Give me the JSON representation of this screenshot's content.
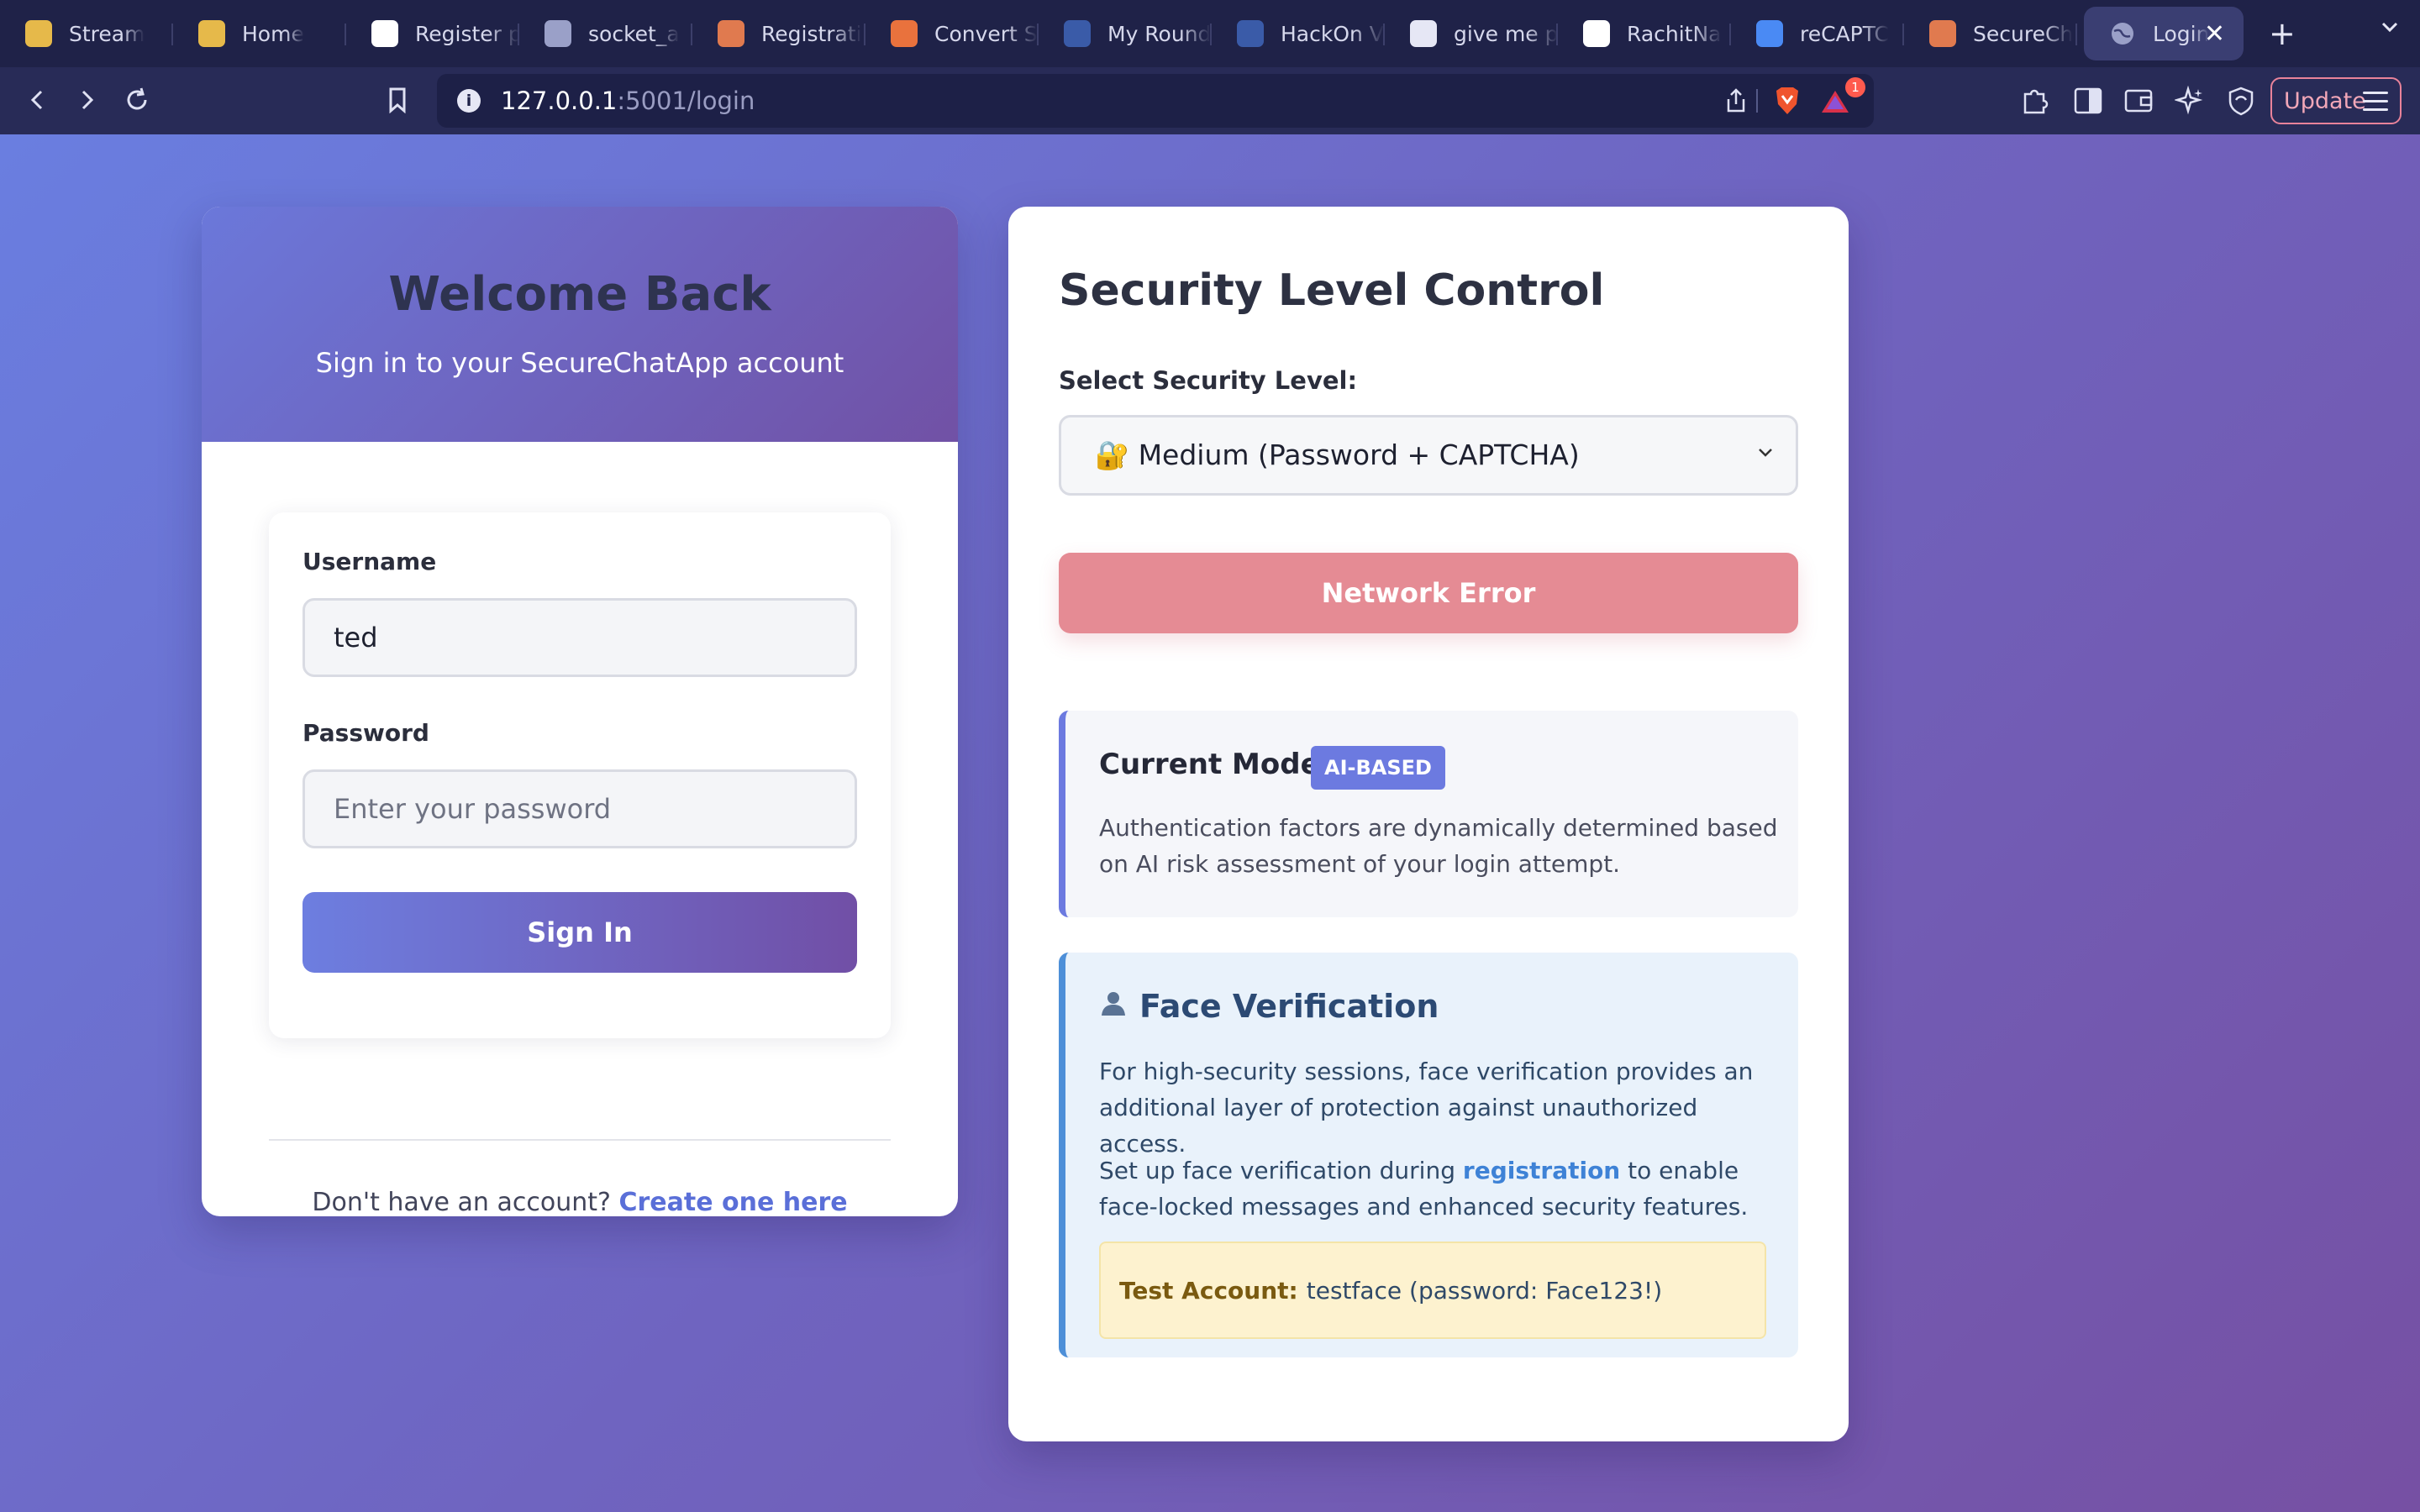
{
  "browser": {
    "tabs": [
      {
        "title": "Stream",
        "favicon": "drive-icon",
        "color": "#e6b94a"
      },
      {
        "title": "Home",
        "favicon": "drive-icon",
        "color": "#e6b94a"
      },
      {
        "title": "Register p",
        "favicon": "openai-icon",
        "color": "#ffffff"
      },
      {
        "title": "socket_a",
        "favicon": "globe-icon",
        "color": "#9aa0c8"
      },
      {
        "title": "Registrati",
        "favicon": "claude-icon",
        "color": "#e07a4f"
      },
      {
        "title": "Convert S",
        "favicon": "convert-icon",
        "color": "#e9723d"
      },
      {
        "title": "My Round",
        "favicon": "unstop-icon",
        "color": "#3a5ba8"
      },
      {
        "title": "HackOn V",
        "favicon": "unstop-icon",
        "color": "#3a5ba8"
      },
      {
        "title": "give me p",
        "favicon": "brave-search-icon",
        "color": "#e6e7f5"
      },
      {
        "title": "RachitNa",
        "favicon": "github-icon",
        "color": "#ffffff"
      },
      {
        "title": "reCAPTC",
        "favicon": "recaptcha-icon",
        "color": "#4a8af4"
      },
      {
        "title": "SecureCh",
        "favicon": "claude-icon",
        "color": "#e07a4f"
      }
    ],
    "active_tab": {
      "title": "Login",
      "favicon": "globe-icon"
    },
    "url_host": "127.0.0.1",
    "url_path": ":5001/login",
    "update_label": "Update",
    "shields_count": "1"
  },
  "login": {
    "title": "Welcome Back",
    "subtitle": "Sign in to your SecureChatApp account",
    "username_label": "Username",
    "username_value": "ted",
    "password_label": "Password",
    "password_placeholder": "Enter your password",
    "signin_label": "Sign In",
    "signup_prompt": "Don't have an account?",
    "signup_link": "Create one here"
  },
  "security": {
    "title": "Security Level Control",
    "select_label": "Select Security Level:",
    "selected_level": "🔐 Medium (Password + CAPTCHA)",
    "error_button": "Network Error",
    "mode_label": "Current Mode:",
    "mode_badge": "AI-BASED",
    "mode_description": "Authentication factors are dynamically determined based on AI risk assessment of your login attempt.",
    "face_title": "Face Verification",
    "face_p1": "For high-security sessions, face verification provides an additional layer of protection against unauthorized access.",
    "face_p2_pre": "Set up face verification during",
    "face_p2_link": "registration",
    "face_p2_post": "to enable face-locked messages and enhanced security features.",
    "test_label": "Test Account:",
    "test_value": "testface (password: Face123!)"
  }
}
